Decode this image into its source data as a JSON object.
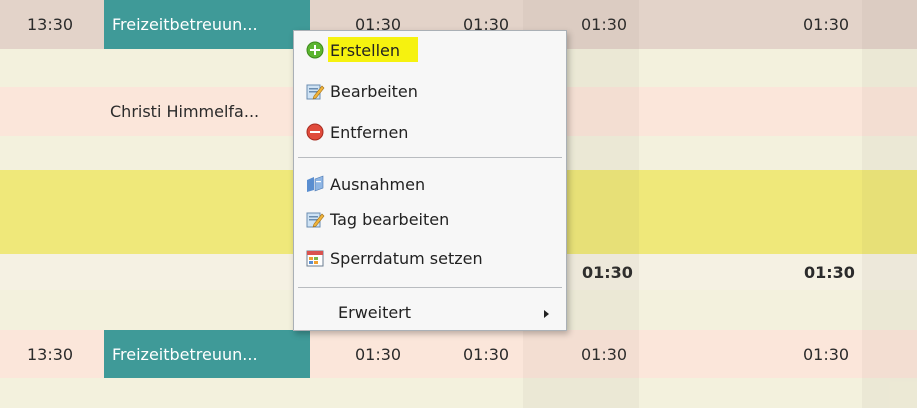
{
  "rows": {
    "row1": {
      "time": "13:30",
      "task": "Freizeitbetreuun...",
      "c1": "01:30",
      "c2": "01:30",
      "c3": "01:30",
      "c4": "01:30"
    },
    "row2": {
      "person": "Christi Himmelfa..."
    },
    "row3": {
      "c3": "01:30",
      "c4": "01:30"
    },
    "row4": {
      "time": "13:30",
      "task": "Freizeitbetreuun...",
      "c1": "01:30",
      "c2": "01:30",
      "c3": "01:30",
      "c4": "01:30"
    }
  },
  "context_menu": {
    "items": [
      {
        "label": "Erstellen",
        "icon": "green-plus-icon"
      },
      {
        "label": "Bearbeiten",
        "icon": "edit-pencil-icon"
      },
      {
        "label": "Entfernen",
        "icon": "red-minus-icon"
      },
      {
        "label": "Ausnahmen",
        "icon": "exceptions-icon"
      },
      {
        "label": "Tag bearbeiten",
        "icon": "edit-day-icon"
      },
      {
        "label": "Sperrdatum setzen",
        "icon": "lock-date-icon"
      },
      {
        "label": "Erweitert",
        "icon": "submenu-arrow-icon"
      }
    ],
    "highlighted_item": "Erstellen",
    "highlight_color": "#f6f20f"
  },
  "colors": {
    "task_cell": "#3f9a98",
    "row_brown": "#e3d3c9",
    "row_yellow": "#efe87a",
    "row_pink": "#fbe6da"
  }
}
